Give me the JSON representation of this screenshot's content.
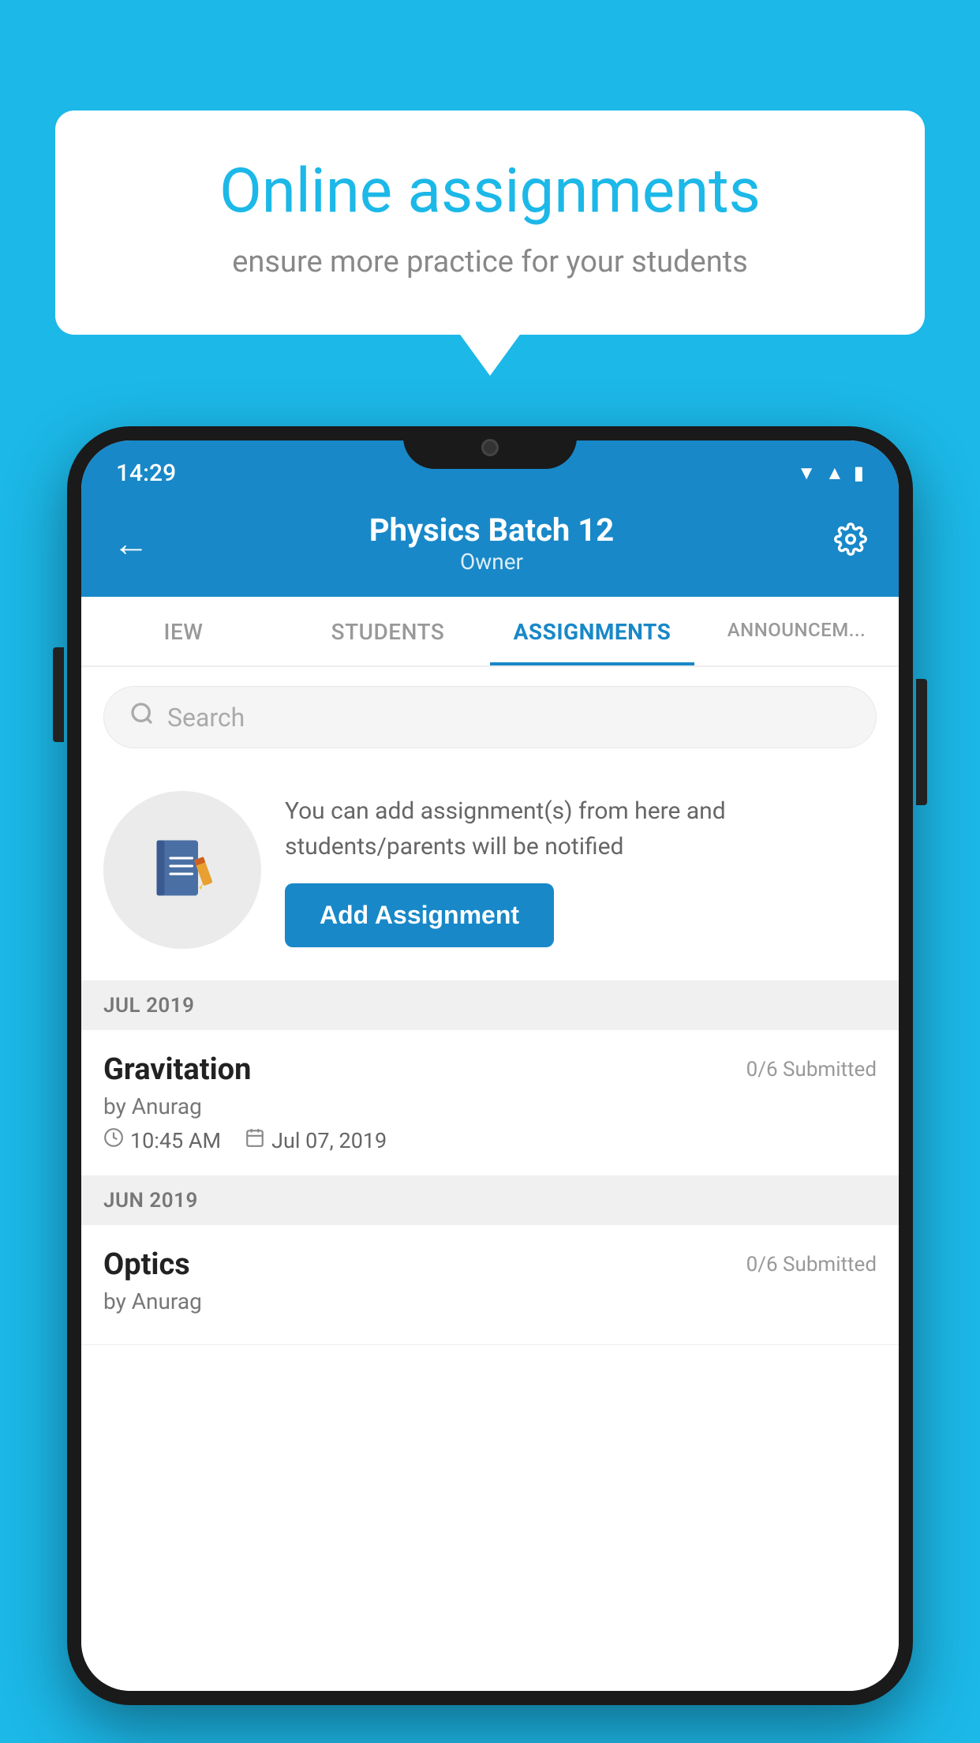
{
  "background_color": "#1cb8e8",
  "speech_bubble": {
    "title": "Online assignments",
    "subtitle": "ensure more practice for your students"
  },
  "phone": {
    "status_bar": {
      "time": "14:29",
      "icons": [
        "wifi",
        "signal",
        "battery"
      ]
    },
    "header": {
      "title": "Physics Batch 12",
      "subtitle": "Owner",
      "back_label": "←",
      "settings_label": "⚙"
    },
    "tabs": [
      {
        "label": "IEW",
        "active": false
      },
      {
        "label": "STUDENTS",
        "active": false
      },
      {
        "label": "ASSIGNMENTS",
        "active": true
      },
      {
        "label": "ANNOUNCEM...",
        "active": false
      }
    ],
    "search": {
      "placeholder": "Search"
    },
    "add_assignment": {
      "description": "You can add assignment(s) from here and students/parents will be notified",
      "button_label": "Add Assignment"
    },
    "sections": [
      {
        "month": "JUL 2019",
        "assignments": [
          {
            "name": "Gravitation",
            "submitted": "0/6 Submitted",
            "by": "by Anurag",
            "time": "10:45 AM",
            "date": "Jul 07, 2019"
          }
        ]
      },
      {
        "month": "JUN 2019",
        "assignments": [
          {
            "name": "Optics",
            "submitted": "0/6 Submitted",
            "by": "by Anurag",
            "time": "",
            "date": ""
          }
        ]
      }
    ]
  }
}
